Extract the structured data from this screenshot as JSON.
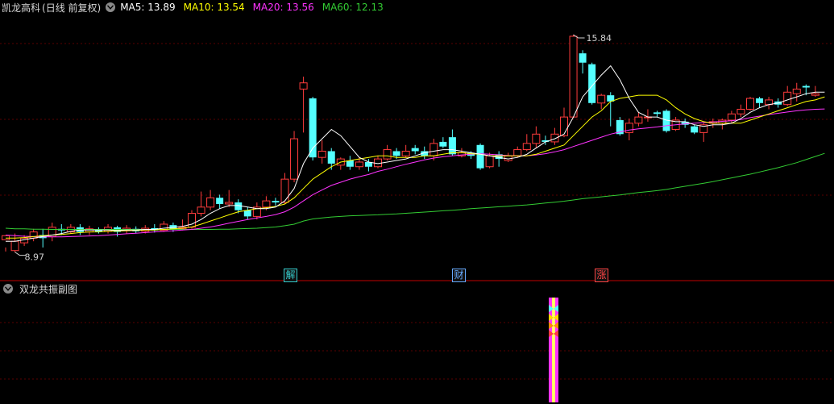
{
  "main_header": {
    "stock_name": "凯龙高科",
    "mode": "(日线 前复权)",
    "icon": "chevron-down-icon",
    "ma_items": [
      {
        "label": "MA5: 13.89",
        "color": "#ffffff"
      },
      {
        "label": "MA10: 13.54",
        "color": "#ffff00"
      },
      {
        "label": "MA20: 13.56",
        "color": "#ff33ff"
      },
      {
        "label": "MA60: 12.13",
        "color": "#33cc33"
      }
    ]
  },
  "sub_header": {
    "title": "双龙共振副图",
    "icon": "chevron-down-icon"
  },
  "price_labels": {
    "high": "15.84",
    "low": "8.97"
  },
  "event_tags": [
    {
      "text": "解",
      "color": "#33cccc"
    },
    {
      "text": "财",
      "color": "#66aaff"
    },
    {
      "text": "涨",
      "color": "#ff4444"
    }
  ],
  "colors": {
    "up": "#ff3c3c",
    "down": "#54ffff",
    "ma5": "#ffffff",
    "ma10": "#ffff00",
    "ma20": "#ff33ff",
    "ma60": "#33cc33",
    "grid": "#5a0000",
    "divider": "#c00000",
    "signal_outer": "#ff33ff",
    "signal_inner": "#ffff66"
  },
  "chart_data": {
    "type": "candlestick",
    "y_range": [
      8.5,
      16.6
    ],
    "candles": [
      [
        9.35,
        9.48,
        9.1,
        8.97
      ],
      [
        9.0,
        9.3,
        9.55,
        8.95
      ],
      [
        9.25,
        9.4,
        9.5,
        9.15
      ],
      [
        9.4,
        9.6,
        9.7,
        9.3
      ],
      [
        9.5,
        9.4,
        9.7,
        9.1
      ],
      [
        9.45,
        9.75,
        9.9,
        9.3
      ],
      [
        9.7,
        9.65,
        9.85,
        9.5
      ],
      [
        9.6,
        9.75,
        9.85,
        9.55
      ],
      [
        9.75,
        9.6,
        9.85,
        9.5
      ],
      [
        9.6,
        9.7,
        9.8,
        9.5
      ],
      [
        9.65,
        9.6,
        9.75,
        9.55
      ],
      [
        9.62,
        9.75,
        9.85,
        9.55
      ],
      [
        9.75,
        9.6,
        9.8,
        9.45
      ],
      [
        9.65,
        9.72,
        9.82,
        9.55
      ],
      [
        9.7,
        9.62,
        9.78,
        9.55
      ],
      [
        9.62,
        9.72,
        9.82,
        9.55
      ],
      [
        9.72,
        9.65,
        9.85,
        9.58
      ],
      [
        9.65,
        9.85,
        9.95,
        9.6
      ],
      [
        9.82,
        9.7,
        9.9,
        9.6
      ],
      [
        9.7,
        9.75,
        10.0,
        9.65
      ],
      [
        9.75,
        10.2,
        10.3,
        9.7
      ],
      [
        10.2,
        10.4,
        10.9,
        10.1
      ],
      [
        10.4,
        10.7,
        10.95,
        10.3
      ],
      [
        10.7,
        10.5,
        10.8,
        10.35
      ],
      [
        10.5,
        10.55,
        10.95,
        10.4
      ],
      [
        10.55,
        10.3,
        10.65,
        10.2
      ],
      [
        10.3,
        10.1,
        10.4,
        10.0
      ],
      [
        10.1,
        10.4,
        10.55,
        10.0
      ],
      [
        10.4,
        10.6,
        10.75,
        10.3
      ],
      [
        10.6,
        10.55,
        10.7,
        10.45
      ],
      [
        10.55,
        11.3,
        11.5,
        10.5
      ],
      [
        11.3,
        12.6,
        12.85,
        11.2
      ],
      [
        14.2,
        14.4,
        14.6,
        12.8
      ],
      [
        13.9,
        12.0,
        13.95,
        11.9
      ],
      [
        12.0,
        12.2,
        12.55,
        11.8
      ],
      [
        12.2,
        11.8,
        12.3,
        11.6
      ],
      [
        11.75,
        11.95,
        12.0,
        11.6
      ],
      [
        11.9,
        11.7,
        12.05,
        11.6
      ],
      [
        11.7,
        11.85,
        12.0,
        11.6
      ],
      [
        11.85,
        11.7,
        11.95,
        11.55
      ],
      [
        11.7,
        11.95,
        12.05,
        11.65
      ],
      [
        11.95,
        12.25,
        12.4,
        11.9
      ],
      [
        12.2,
        12.05,
        12.3,
        11.95
      ],
      [
        12.05,
        12.2,
        12.4,
        12.0
      ],
      [
        12.3,
        12.2,
        12.4,
        12.1
      ],
      [
        12.2,
        12.05,
        12.35,
        11.95
      ],
      [
        12.05,
        12.45,
        12.6,
        11.9
      ],
      [
        12.5,
        12.35,
        12.65,
        12.3
      ],
      [
        12.65,
        12.1,
        12.9,
        12.05
      ],
      [
        12.05,
        12.15,
        12.3,
        12.0
      ],
      [
        12.15,
        12.05,
        12.2,
        11.95
      ],
      [
        12.4,
        11.65,
        12.45,
        11.6
      ],
      [
        11.7,
        12.05,
        12.15,
        11.65
      ],
      [
        12.1,
        11.95,
        12.2,
        11.7
      ],
      [
        11.9,
        12.05,
        12.15,
        11.85
      ],
      [
        12.05,
        12.25,
        12.35,
        12.0
      ],
      [
        12.25,
        12.45,
        12.75,
        12.2
      ],
      [
        12.45,
        12.75,
        13.0,
        12.3
      ],
      [
        12.55,
        12.5,
        12.7,
        12.4
      ],
      [
        12.5,
        12.75,
        12.95,
        12.4
      ],
      [
        12.7,
        13.3,
        13.6,
        12.65
      ],
      [
        13.3,
        15.9,
        15.95,
        13.3
      ],
      [
        15.35,
        15.05,
        15.45,
        14.7
      ],
      [
        15.0,
        13.75,
        15.05,
        13.7
      ],
      [
        13.75,
        14.0,
        14.05,
        13.55
      ],
      [
        14.0,
        13.8,
        14.1,
        13.0
      ],
      [
        13.2,
        12.75,
        13.3,
        12.7
      ],
      [
        12.8,
        13.1,
        13.25,
        12.55
      ],
      [
        13.1,
        13.3,
        13.45,
        13.0
      ],
      [
        13.3,
        13.3,
        13.55,
        13.15
      ],
      [
        13.45,
        13.4,
        13.5,
        13.3
      ],
      [
        13.5,
        12.85,
        13.55,
        12.8
      ],
      [
        12.9,
        13.2,
        13.3,
        12.85
      ],
      [
        13.15,
        13.05,
        13.25,
        12.95
      ],
      [
        13.0,
        12.8,
        13.05,
        12.75
      ],
      [
        12.8,
        13.05,
        13.1,
        12.5
      ],
      [
        13.1,
        13.15,
        13.25,
        12.95
      ],
      [
        13.1,
        13.2,
        13.25,
        12.9
      ],
      [
        13.2,
        13.4,
        13.5,
        13.1
      ],
      [
        13.4,
        13.55,
        13.7,
        13.3
      ],
      [
        13.55,
        13.9,
        13.95,
        13.5
      ],
      [
        13.9,
        13.75,
        13.95,
        13.6
      ],
      [
        13.7,
        13.85,
        13.95,
        13.55
      ],
      [
        13.8,
        13.7,
        13.9,
        13.6
      ],
      [
        13.7,
        14.1,
        14.3,
        13.65
      ],
      [
        14.05,
        14.2,
        14.4,
        13.8
      ],
      [
        14.3,
        14.25,
        14.35,
        14.0
      ],
      [
        14.0,
        14.05,
        14.3,
        13.95
      ]
    ],
    "ma5": [
      9.3,
      9.3,
      9.35,
      9.4,
      9.45,
      9.5,
      9.55,
      9.62,
      9.66,
      9.66,
      9.66,
      9.66,
      9.65,
      9.66,
      9.66,
      9.68,
      9.68,
      9.72,
      9.75,
      9.78,
      9.85,
      10.0,
      10.2,
      10.35,
      10.45,
      10.45,
      10.4,
      10.35,
      10.35,
      10.4,
      10.6,
      11.0,
      11.8,
      12.3,
      12.6,
      12.9,
      12.7,
      12.35,
      12.0,
      11.85,
      11.8,
      11.85,
      11.9,
      11.95,
      12.05,
      12.15,
      12.2,
      12.25,
      12.25,
      12.2,
      12.15,
      12.1,
      12.05,
      12.0,
      11.95,
      12.0,
      12.1,
      12.3,
      12.5,
      12.6,
      12.75,
      13.3,
      13.95,
      14.3,
      14.65,
      14.95,
      14.5,
      13.9,
      13.45,
      13.3,
      13.3,
      13.2,
      13.15,
      13.15,
      13.05,
      13.0,
      13.05,
      13.05,
      13.1,
      13.25,
      13.45,
      13.6,
      13.7,
      13.75,
      13.85,
      13.95,
      14.05,
      14.1,
      14.1
    ],
    "ma10": [
      9.4,
      9.4,
      9.42,
      9.45,
      9.48,
      9.5,
      9.52,
      9.55,
      9.58,
      9.6,
      9.6,
      9.62,
      9.63,
      9.64,
      9.65,
      9.66,
      9.66,
      9.68,
      9.7,
      9.72,
      9.76,
      9.85,
      9.95,
      10.05,
      10.15,
      10.25,
      10.3,
      10.35,
      10.38,
      10.42,
      10.5,
      10.7,
      11.0,
      11.3,
      11.5,
      11.7,
      11.85,
      11.9,
      11.95,
      12.0,
      12.05,
      12.05,
      12.0,
      12.0,
      12.0,
      12.05,
      12.05,
      12.1,
      12.15,
      12.15,
      12.12,
      12.1,
      12.05,
      12.05,
      12.05,
      12.05,
      12.05,
      12.1,
      12.2,
      12.3,
      12.4,
      12.7,
      13.0,
      13.3,
      13.5,
      13.8,
      13.9,
      13.95,
      14.0,
      14.0,
      14.0,
      13.85,
      13.6,
      13.4,
      13.25,
      13.15,
      13.1,
      13.1,
      13.1,
      13.1,
      13.2,
      13.3,
      13.4,
      13.5,
      13.6,
      13.7,
      13.8,
      13.85,
      13.95
    ],
    "ma20": [
      9.5,
      9.48,
      9.46,
      9.45,
      9.44,
      9.44,
      9.44,
      9.45,
      9.46,
      9.47,
      9.48,
      9.5,
      9.52,
      9.54,
      9.56,
      9.58,
      9.6,
      9.62,
      9.64,
      9.66,
      9.68,
      9.72,
      9.76,
      9.82,
      9.88,
      9.94,
      10.0,
      10.05,
      10.1,
      10.16,
      10.25,
      10.4,
      10.6,
      10.8,
      10.95,
      11.1,
      11.2,
      11.3,
      11.38,
      11.45,
      11.55,
      11.62,
      11.7,
      11.78,
      11.85,
      11.92,
      11.98,
      12.02,
      12.05,
      12.08,
      12.1,
      12.12,
      12.1,
      12.08,
      12.06,
      12.05,
      12.05,
      12.08,
      12.12,
      12.18,
      12.25,
      12.35,
      12.45,
      12.55,
      12.65,
      12.75,
      12.82,
      12.88,
      12.92,
      12.95,
      12.98,
      13.02,
      13.05,
      13.08,
      13.1,
      13.12,
      13.14,
      13.16,
      13.18,
      13.22,
      13.28,
      13.33,
      13.38,
      13.42,
      13.46,
      13.5,
      13.53,
      13.55,
      13.56
    ],
    "ma60": [
      9.72,
      9.7,
      9.7,
      9.69,
      9.69,
      9.68,
      9.68,
      9.68,
      9.68,
      9.68,
      9.68,
      9.68,
      9.68,
      9.68,
      9.68,
      9.68,
      9.68,
      9.68,
      9.68,
      9.68,
      9.68,
      9.68,
      9.68,
      9.69,
      9.69,
      9.7,
      9.71,
      9.72,
      9.74,
      9.76,
      9.8,
      9.85,
      9.95,
      10.02,
      10.05,
      10.08,
      10.1,
      10.12,
      10.13,
      10.14,
      10.15,
      10.17,
      10.18,
      10.2,
      10.22,
      10.24,
      10.26,
      10.28,
      10.3,
      10.32,
      10.35,
      10.37,
      10.39,
      10.41,
      10.43,
      10.45,
      10.47,
      10.5,
      10.53,
      10.56,
      10.59,
      10.63,
      10.67,
      10.7,
      10.73,
      10.76,
      10.79,
      10.83,
      10.87,
      10.9,
      10.93,
      10.97,
      11.02,
      11.07,
      11.12,
      11.17,
      11.22,
      11.28,
      11.34,
      11.4,
      11.46,
      11.53,
      11.6,
      11.67,
      11.75,
      11.83,
      11.93,
      12.03,
      12.13
    ],
    "signal_index": 45
  }
}
